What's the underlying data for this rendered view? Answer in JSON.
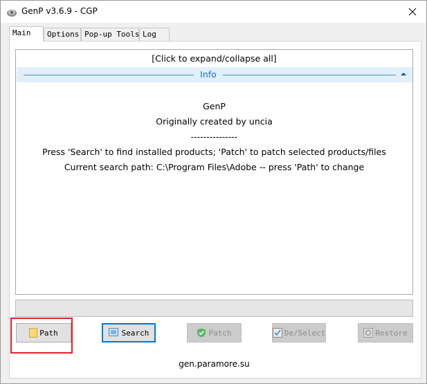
{
  "window": {
    "title": "GenP v3.6.9 - CGP"
  },
  "tabs": [
    {
      "label": "Main",
      "active": true
    },
    {
      "label": "Options",
      "active": false
    },
    {
      "label": "Pop-up Tools",
      "active": false
    },
    {
      "label": "Log",
      "active": false
    }
  ],
  "console": {
    "expand_label": "[Click to expand/collapse all]",
    "section_label": "Info",
    "lines": [
      "GenP",
      "Originally created by uncia",
      "---------------",
      "Press 'Search' to find installed products; 'Patch' to patch selected products/files",
      "Current search path: C:\\Program Files\\Adobe -- press 'Path' to change"
    ]
  },
  "progress": {
    "value": 0
  },
  "buttons": {
    "path": "Path",
    "search": "Search",
    "patch": "Patch",
    "deselect": "De/Select",
    "restore": "Restore"
  },
  "footer": {
    "link": "gen.paramore.su"
  },
  "colors": {
    "accent": "#0078d7",
    "highlight": "#e0202a",
    "info_bar": "#e2f0fc"
  }
}
